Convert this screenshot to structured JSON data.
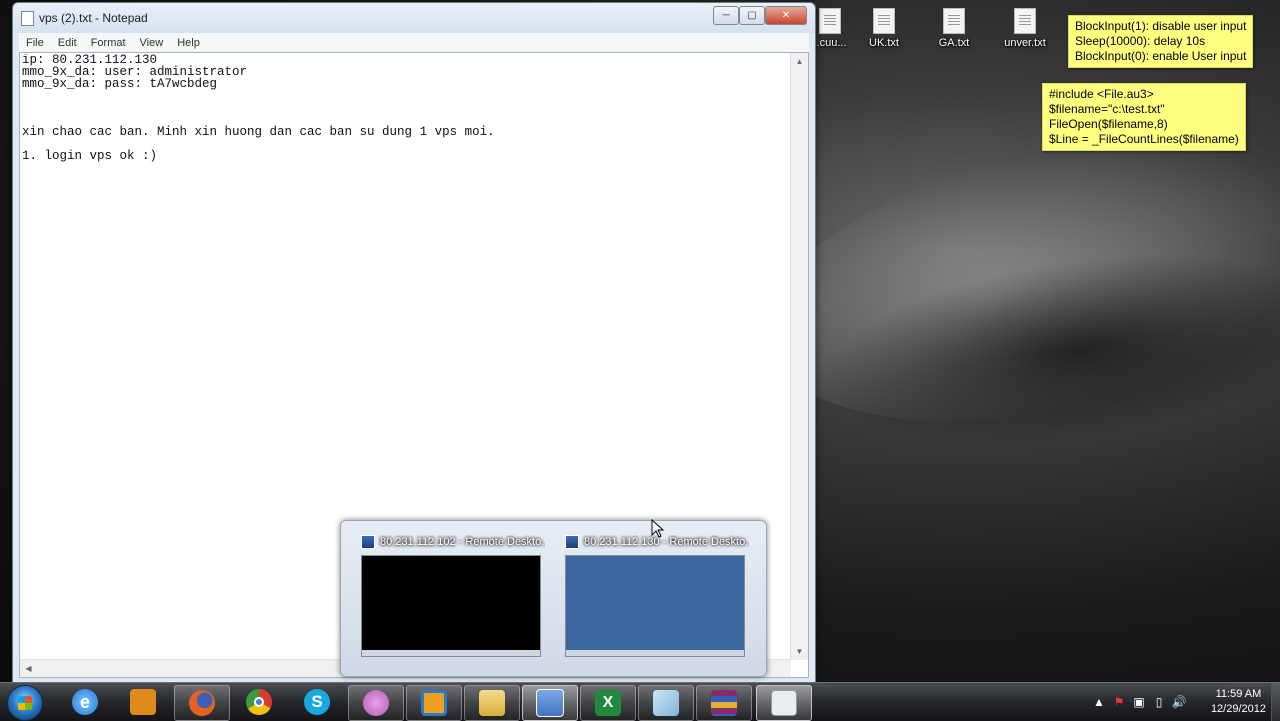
{
  "desktop": {
    "icons": [
      {
        "label": "..cuu..."
      },
      {
        "label": "UK.txt"
      },
      {
        "label": "GA.txt"
      },
      {
        "label": "unver.txt"
      }
    ],
    "sticky_notes": [
      {
        "lines": [
          "BlockInput(1): disable user input",
          "Sleep(10000): delay 10s",
          "BlockInput(0): enable User input"
        ]
      },
      {
        "lines": [
          "#include <File.au3>",
          "$filename=\"c:\\test.txt\"",
          "FileOpen($filename,8)",
          "$Line = _FileCountLines($filename)"
        ]
      }
    ]
  },
  "notepad": {
    "title": "vps (2).txt - Notepad",
    "menu": [
      "File",
      "Edit",
      "Format",
      "View",
      "Help"
    ],
    "content_lines": [
      "ip: 80.231.112.130",
      "mmo_9x_da: user: administrator",
      "mmo_9x_da: pass: tA7wcbdeg",
      "",
      "",
      "",
      "xin chao cac ban. Minh xin huong dan cac ban su dung 1 vps moi.",
      "",
      "1. login vps ok :)"
    ],
    "icons": {
      "minimize": "minimize-icon",
      "maximize": "maximize-icon",
      "close": "close-icon"
    }
  },
  "taskbar_preview": {
    "items": [
      {
        "title": "80.231.112.102 - Remote Deskto...",
        "preview_color": "#000000"
      },
      {
        "title": "80.231.112.130 - Remote Deskto...",
        "preview_color": "#3a689e"
      }
    ]
  },
  "taskbar": {
    "apps": [
      {
        "name": "internet-explorer-icon",
        "color": "#1f7ad8"
      },
      {
        "name": "media-player-icon",
        "color": "#e08a1e"
      },
      {
        "name": "firefox-icon",
        "color": "#e5621e"
      },
      {
        "name": "chrome-icon",
        "color": "#3a9c3c"
      },
      {
        "name": "skype-icon",
        "color": "#18a8e0"
      },
      {
        "name": "messenger-icon",
        "color": "#b95ab9"
      },
      {
        "name": "app-icon",
        "color": "#f0a020"
      },
      {
        "name": "folder-icon",
        "color": "#e8c45a"
      },
      {
        "name": "remote-desktop-icon",
        "color": "#3f74c2"
      },
      {
        "name": "excel-icon",
        "color": "#1f8a3d"
      },
      {
        "name": "app2-icon",
        "color": "#7fb3d8"
      },
      {
        "name": "winrar-icon",
        "color": "#8a2a6a"
      },
      {
        "name": "notepad-icon",
        "color": "#e9edf2"
      }
    ],
    "clock": {
      "time": "11:59 AM",
      "date": "12/29/2012"
    }
  }
}
